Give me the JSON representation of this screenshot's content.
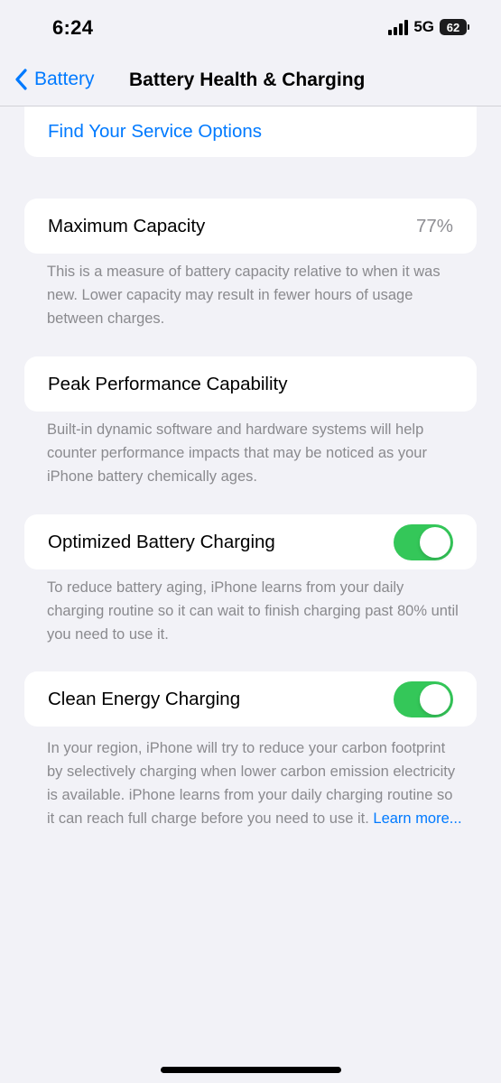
{
  "status_bar": {
    "time": "6:24",
    "network": "5G",
    "battery_level": "62"
  },
  "nav": {
    "back_label": "Battery",
    "title": "Battery Health & Charging"
  },
  "service": {
    "link_label": "Find Your Service Options"
  },
  "capacity": {
    "label": "Maximum Capacity",
    "value": "77%",
    "footer": "This is a measure of battery capacity relative to when it was new. Lower capacity may result in fewer hours of usage between charges."
  },
  "peak": {
    "label": "Peak Performance Capability",
    "footer": "Built-in dynamic software and hardware systems will help counter performance impacts that may be noticed as your iPhone battery chemically ages."
  },
  "optimized": {
    "label": "Optimized Battery Charging",
    "enabled": true,
    "footer": "To reduce battery aging, iPhone learns from your daily charging routine so it can wait to finish charging past 80% until you need to use it."
  },
  "clean_energy": {
    "label": "Clean Energy Charging",
    "enabled": true,
    "footer": "In your region, iPhone will try to reduce your carbon footprint by selectively charging when lower carbon emission electricity is available. iPhone learns from your daily charging routine so it can reach full charge before you need to use it.",
    "learn_more": "Learn more..."
  },
  "colors": {
    "accent": "#007aff",
    "toggle_on": "#34c759",
    "background": "#f2f2f7"
  }
}
